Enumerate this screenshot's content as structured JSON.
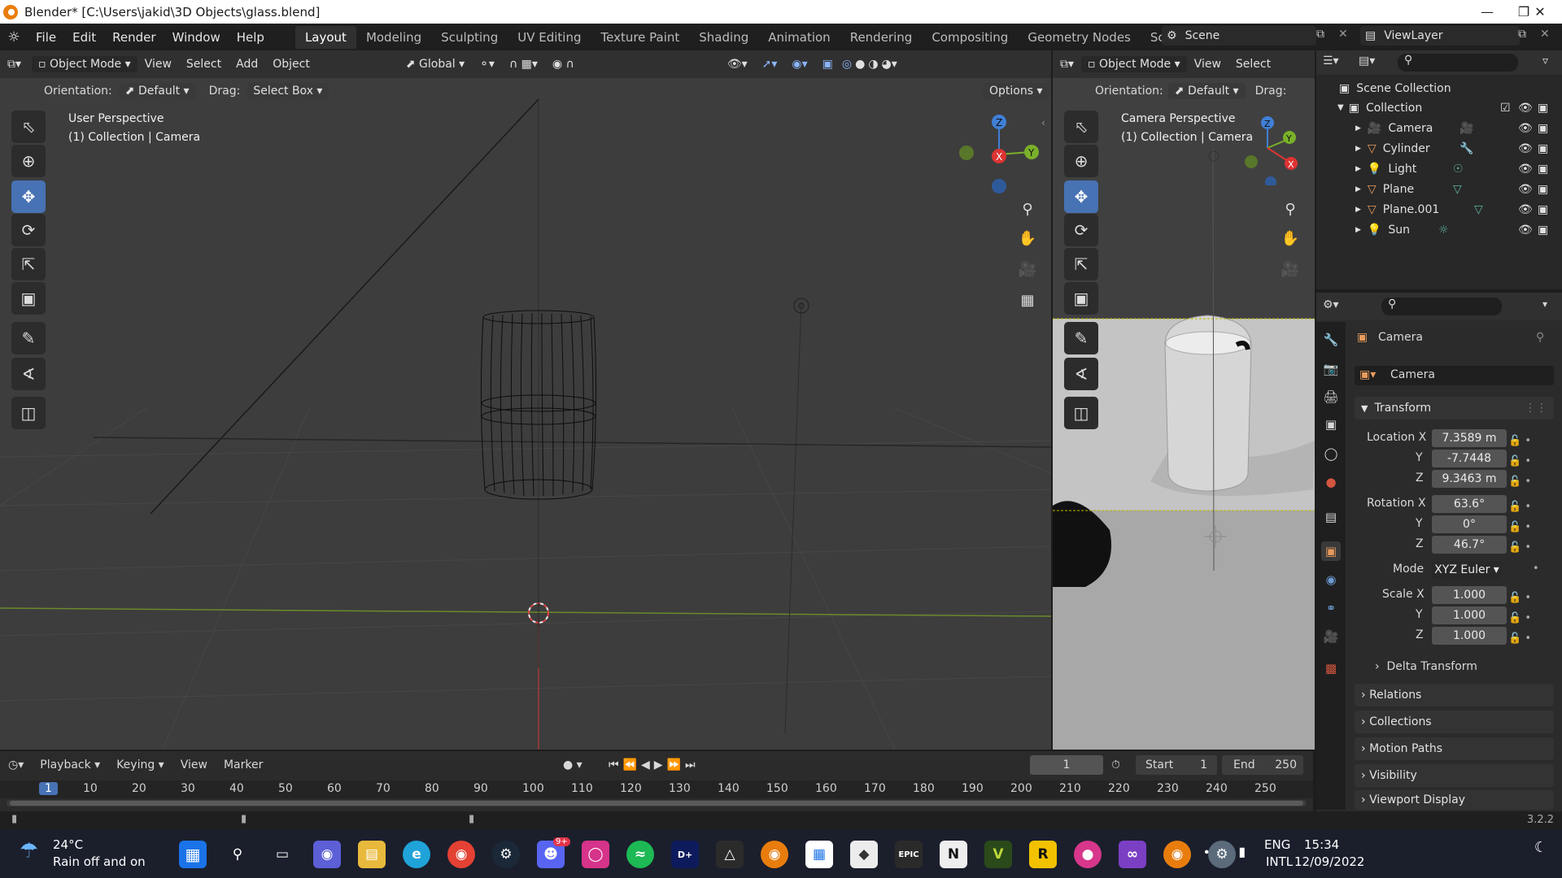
{
  "window": {
    "title": "Blender* [C:\\Users\\jakid\\3D Objects\\glass.blend]",
    "minimize_icon": "minimize-icon",
    "maximize_icon": "maximize-icon",
    "close_icon": "close-icon"
  },
  "menus": [
    "File",
    "Edit",
    "Render",
    "Window",
    "Help"
  ],
  "workspaces": [
    "Layout",
    "Modeling",
    "Sculpting",
    "UV Editing",
    "Texture Paint",
    "Shading",
    "Animation",
    "Rendering",
    "Compositing",
    "Geometry Nodes",
    "Scripting",
    "+"
  ],
  "active_workspace": "Layout",
  "scene": {
    "label": "Scene",
    "view_layer": "ViewLayer"
  },
  "viewport_main": {
    "mode": "Object Mode",
    "menu": [
      "View",
      "Select",
      "Add",
      "Object"
    ],
    "transform": "Global",
    "orientation_label": "Orientation:",
    "orientation_value": "Default",
    "drag_label": "Drag:",
    "drag_value": "Select Box",
    "options": "Options",
    "perspective": "User Perspective",
    "context": "(1) Collection | Camera"
  },
  "viewport_camera": {
    "mode": "Object Mode",
    "menu": [
      "View",
      "Select"
    ],
    "orientation_label": "Orientation:",
    "orientation_value": "Default",
    "drag_label": "Drag:",
    "perspective": "Camera Perspective",
    "context": "(1) Collection | Camera"
  },
  "outliner": {
    "root": "Scene Collection",
    "collection": "Collection",
    "items": [
      "Camera",
      "Cylinder",
      "Light",
      "Plane",
      "Plane.001",
      "Sun"
    ]
  },
  "properties": {
    "object_name": "Camera",
    "data_name": "Camera",
    "transform_label": "Transform",
    "location_label": "Location X",
    "location": [
      "7.3589 m",
      "-7.7448",
      "9.3463 m"
    ],
    "rotation_label": "Rotation X",
    "rotation": [
      "63.6°",
      "0°",
      "46.7°"
    ],
    "mode_label": "Mode",
    "mode_value": "XYZ Euler",
    "scale_label": "Scale X",
    "scale": [
      "1.000",
      "1.000",
      "1.000"
    ],
    "axis_y": "Y",
    "axis_z": "Z",
    "sections": [
      "Delta Transform",
      "Relations",
      "Collections",
      "Motion Paths",
      "Visibility",
      "Viewport Display"
    ]
  },
  "timeline": {
    "menu": [
      "Playback",
      "Keying",
      "View",
      "Marker"
    ],
    "current_frame": "1",
    "start_label": "Start",
    "start_value": "1",
    "end_label": "End",
    "end_value": "250",
    "ruler": [
      "1",
      "10",
      "20",
      "30",
      "40",
      "50",
      "60",
      "70",
      "80",
      "90",
      "100",
      "110",
      "120",
      "130",
      "140",
      "150",
      "160",
      "170",
      "180",
      "190",
      "200",
      "210",
      "220",
      "230",
      "240",
      "250"
    ]
  },
  "status": {
    "version": "3.2.2"
  },
  "taskbar": {
    "weather_temp": "24°C",
    "weather_desc": "Rain off and on",
    "lang": "ENG",
    "lang2": "INTL",
    "time": "15:34",
    "date": "12/09/2022",
    "badge": "9+"
  }
}
